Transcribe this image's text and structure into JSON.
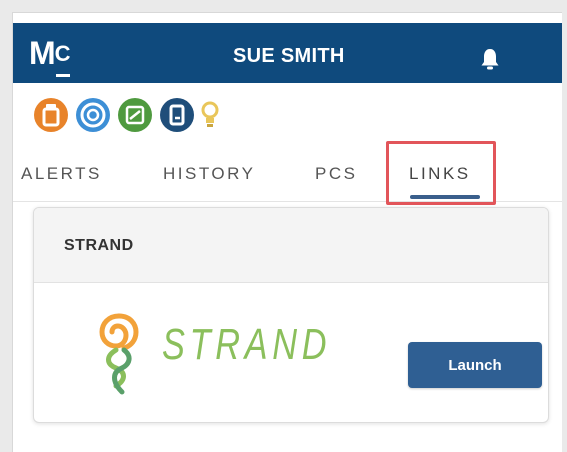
{
  "header": {
    "logo_text": "M",
    "logo_sub": "C",
    "user_name": "SUE SMITH",
    "icon": "bell-icon",
    "background_color": "#0f4a7d"
  },
  "app_icons": [
    {
      "name": "orange-app-icon",
      "color": "#e8832a"
    },
    {
      "name": "blue-app-icon",
      "color": "#3d8fd6"
    },
    {
      "name": "green-app-icon",
      "color": "#4f9a3f"
    },
    {
      "name": "navy-app-icon",
      "color": "#1f4e7a"
    },
    {
      "name": "lightbulb-icon",
      "color": "#e9c65a"
    }
  ],
  "tabs": [
    {
      "label": "ALERTS"
    },
    {
      "label": "HISTORY"
    },
    {
      "label": "PCS"
    },
    {
      "label": "LINKS",
      "active": true
    }
  ],
  "highlight_color": "#e2555a",
  "card": {
    "title": "STRAND",
    "brand": "STRAND",
    "brand_color": "#8bbf5c",
    "launch_label": "Launch",
    "button_color": "#2f5f93"
  }
}
